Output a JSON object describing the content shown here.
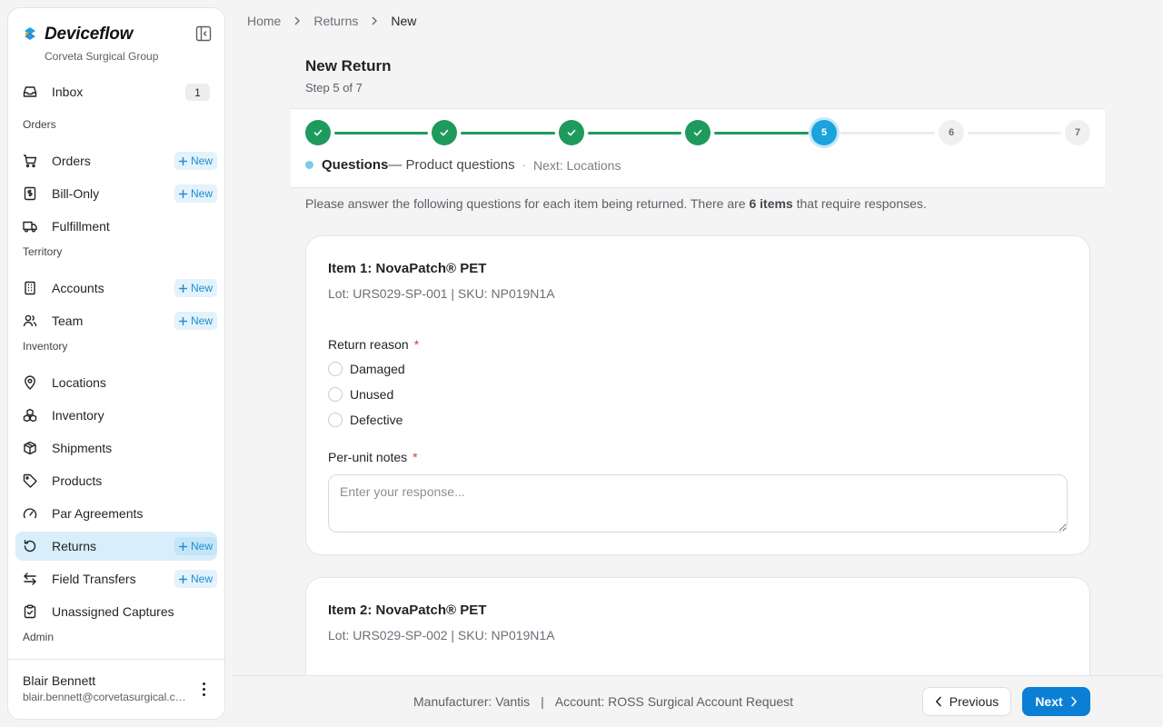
{
  "app": {
    "name": "Deviceflow",
    "org": "Corveta Surgical Group"
  },
  "sidebar": {
    "inbox": {
      "label": "Inbox",
      "count": "1"
    },
    "sections": {
      "orders": "Orders",
      "territory": "Territory",
      "inventory": "Inventory",
      "admin": "Admin"
    },
    "new_label": "New",
    "items": [
      {
        "key": "orders",
        "label": "Orders",
        "icon": "cart-icon",
        "has_new": true
      },
      {
        "key": "bill-only",
        "label": "Bill-Only",
        "icon": "receipt-icon",
        "has_new": true
      },
      {
        "key": "fulfillment",
        "label": "Fulfillment",
        "icon": "truck-icon",
        "has_new": false
      },
      {
        "key": "accounts",
        "label": "Accounts",
        "icon": "building-icon",
        "has_new": true
      },
      {
        "key": "team",
        "label": "Team",
        "icon": "users-icon",
        "has_new": true
      },
      {
        "key": "locations",
        "label": "Locations",
        "icon": "map-pin-icon",
        "has_new": false
      },
      {
        "key": "inventory",
        "label": "Inventory",
        "icon": "boxes-icon",
        "has_new": false
      },
      {
        "key": "shipments",
        "label": "Shipments",
        "icon": "package-icon",
        "has_new": false
      },
      {
        "key": "products",
        "label": "Products",
        "icon": "tag-icon",
        "has_new": false
      },
      {
        "key": "par-agreements",
        "label": "Par Agreements",
        "icon": "gauge-icon",
        "has_new": false
      },
      {
        "key": "returns",
        "label": "Returns",
        "icon": "undo-icon",
        "has_new": true,
        "active": true
      },
      {
        "key": "field-transfers",
        "label": "Field Transfers",
        "icon": "arrows-exchange-icon",
        "has_new": true
      },
      {
        "key": "unassigned-captures",
        "label": "Unassigned Captures",
        "icon": "clipboard-check-icon",
        "has_new": false
      }
    ],
    "user": {
      "name": "Blair Bennett",
      "email": "blair.bennett@corvetasurgical.com"
    }
  },
  "breadcrumb": [
    "Home",
    "Returns",
    "New"
  ],
  "page": {
    "title": "New Return",
    "subtitle": "Step 5 of 7"
  },
  "stepper": {
    "total": 7,
    "current": 5,
    "steps": [
      "1",
      "2",
      "3",
      "4",
      "5",
      "6",
      "7"
    ],
    "current_name": "Questions",
    "current_desc": "— Product questions",
    "separator": "·",
    "next_label": "Next: Locations"
  },
  "intro": {
    "prefix": "Please answer the following questions for each item being returned. There are ",
    "count": "6 items",
    "suffix": " that require responses."
  },
  "form": {
    "return_reason_label": "Return reason",
    "required_mark": "*",
    "reason_options": [
      "Damaged",
      "Unused",
      "Defective"
    ],
    "notes_label": "Per-unit notes",
    "notes_placeholder": "Enter your response..."
  },
  "items": [
    {
      "title": "Item 1: NovaPatch® PET",
      "meta": "Lot: URS029-SP-001 | SKU: NP019N1A"
    },
    {
      "title": "Item 2: NovaPatch® PET",
      "meta": "Lot: URS029-SP-002 | SKU: NP019N1A"
    }
  ],
  "footer": {
    "manufacturer_label": "Manufacturer:",
    "manufacturer": "Vantis",
    "separator": "|",
    "account_label": "Account:",
    "account": "ROSS Surgical Account Request",
    "previous": "Previous",
    "next": "Next"
  },
  "colors": {
    "accent": "#0a7fd4",
    "step_done": "#1e9a5c",
    "step_current": "#1aa3dd",
    "active_nav_bg": "#d8eefa",
    "new_pill_text": "#1a8ed1",
    "required": "#d63b3b"
  }
}
